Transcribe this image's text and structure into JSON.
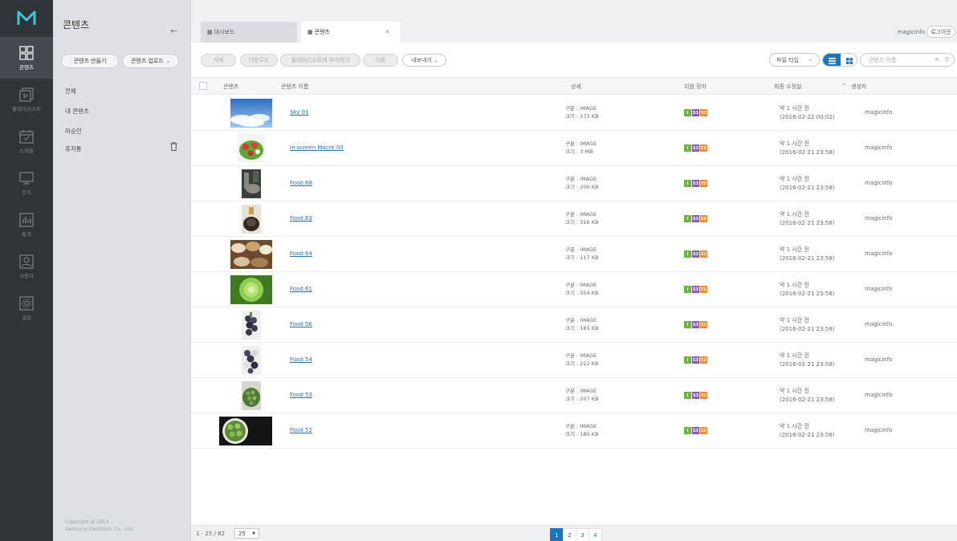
{
  "rail": {
    "items": [
      {
        "label": "콘텐츠",
        "icon": "grid-icon"
      },
      {
        "label": "플레이리스트",
        "icon": "playlist-icon"
      },
      {
        "label": "스케줄",
        "icon": "calendar-icon"
      },
      {
        "label": "장치",
        "icon": "monitor-icon"
      },
      {
        "label": "통계",
        "icon": "chart-icon"
      },
      {
        "label": "사용자",
        "icon": "user-icon"
      },
      {
        "label": "설정",
        "icon": "gear-icon"
      }
    ]
  },
  "sidebar": {
    "title": "콘텐츠",
    "create_label": "콘텐츠 만들기",
    "upload_label": "콘텐츠 업로드",
    "menu": [
      "전체",
      "내 콘텐츠",
      "미승인",
      "휴지통"
    ],
    "copyright_1": "Copyright @ 2014",
    "copyright_2": "Samsung Electronic Co., Ltd."
  },
  "tabs": {
    "dashboard": "대시보드",
    "content": "콘텐츠",
    "close": "×"
  },
  "header": {
    "user": "magicinfo",
    "logout": "로그아웃"
  },
  "toolbar": {
    "delete": "삭제",
    "download": "다운로드",
    "add_to_playlist": "플레이리스트에 추가하기",
    "move": "이동",
    "export": "내보내기",
    "filetype": "파일 타입",
    "search_placeholder": "콘텐츠 이름"
  },
  "table": {
    "headers": {
      "content": "콘텐츠",
      "name": "콘텐츠 이름",
      "detail": "상세",
      "devices": "지원 장치",
      "modified": "최종 수정일",
      "creator": "생성자"
    },
    "rows": [
      {
        "name": "Sky 01",
        "type": "구분 : IMAGE",
        "size": "크기 : 173 KB",
        "ago": "약 1 시간 전",
        "date": "(2016-02-22 00:02)",
        "owner": "magicinfo"
      },
      {
        "name": "In-screen Macre 03",
        "type": "구분 : IMAGE",
        "size": "크기 : 3 MB",
        "ago": "약 1 시간 전",
        "date": "(2016-02-21 23:58)",
        "owner": "magicinfo"
      },
      {
        "name": "Food 68",
        "type": "구분 : IMAGE",
        "size": "크기 : 200 KB",
        "ago": "약 1 시간 전",
        "date": "(2016-02-21 23:58)",
        "owner": "magicinfo"
      },
      {
        "name": "Food 63",
        "type": "구분 : IMAGE",
        "size": "크기 : 316 KB",
        "ago": "약 1 시간 전",
        "date": "(2016-02-21 23:58)",
        "owner": "magicinfo"
      },
      {
        "name": "Food 64",
        "type": "구분 : IMAGE",
        "size": "크기 : 117 KB",
        "ago": "약 1 시간 전",
        "date": "(2016-02-21 23:58)",
        "owner": "magicinfo"
      },
      {
        "name": "Food 61",
        "type": "구분 : IMAGE",
        "size": "크기 : 354 KB",
        "ago": "약 1 시간 전",
        "date": "(2016-02-21 23:58)",
        "owner": "magicinfo"
      },
      {
        "name": "Food 56",
        "type": "구분 : IMAGE",
        "size": "크기 : 181 KB",
        "ago": "약 1 시간 전",
        "date": "(2016-02-21 23:58)",
        "owner": "magicinfo"
      },
      {
        "name": "Food 54",
        "type": "구분 : IMAGE",
        "size": "크기 : 222 KB",
        "ago": "약 1 시간 전",
        "date": "(2016-02-21 23:58)",
        "owner": "magicinfo"
      },
      {
        "name": "Food 53",
        "type": "구분 : IMAGE",
        "size": "크기 : 207 KB",
        "ago": "약 1 시간 전",
        "date": "(2016-02-21 23:58)",
        "owner": "magicinfo"
      },
      {
        "name": "Food 52",
        "type": "구분 : IMAGE",
        "size": "크기 : 180 KB",
        "ago": "약 1 시간 전",
        "date": "(2016-02-21 23:58)",
        "owner": "magicinfo"
      }
    ],
    "device_badges": [
      "I",
      "S3",
      "S2"
    ]
  },
  "footer": {
    "range": "1 - 25 / 82",
    "page_size": "25",
    "pages": [
      "1",
      "2",
      "3",
      "4"
    ]
  },
  "colors": {
    "accent": "#1e74b8",
    "rail_bg": "#2f3438",
    "sidebar_bg": "#dde1e5",
    "badge_i": "#6fb53c",
    "badge_s3": "#8a5bb1",
    "badge_s2": "#ef8a2f"
  }
}
